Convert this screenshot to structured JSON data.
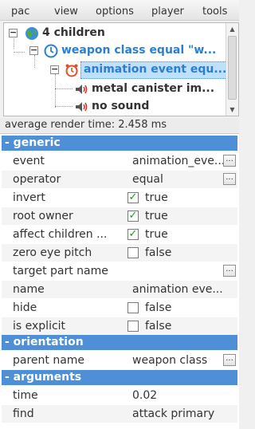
{
  "menu": [
    "pac",
    "view",
    "options",
    "player",
    "tools"
  ],
  "tree": {
    "root": "4 children",
    "child": "weapon class equal \"w...",
    "selected": "animation event equ...",
    "leaf1": "metal canister im...",
    "leaf2": "no sound"
  },
  "status": "average render time: 2.458 ms",
  "sections": {
    "generic": "- generic",
    "orientation": "- orientation",
    "arguments": "- arguments"
  },
  "props": {
    "event": {
      "name": "event",
      "value": "animation_eve..."
    },
    "operator": {
      "name": "operator",
      "value": "equal"
    },
    "invert": {
      "name": "invert",
      "value": "true"
    },
    "root_owner": {
      "name": "root owner",
      "value": "true"
    },
    "affect_children": {
      "name": "affect children ...",
      "value": "true"
    },
    "zero_eye_pitch": {
      "name": "zero eye pitch",
      "value": "false"
    },
    "target_part_name": {
      "name": "target part name",
      "value": ""
    },
    "name": {
      "name": "name",
      "value": "animation eve..."
    },
    "hide": {
      "name": "hide",
      "value": "false"
    },
    "is_explicit": {
      "name": "is explicit",
      "value": "false"
    },
    "parent_name": {
      "name": "parent name",
      "value": "weapon class"
    },
    "time": {
      "name": "time",
      "value": "0.02"
    },
    "find": {
      "name": "find",
      "value": "attack primary"
    }
  },
  "ellipsis_label": "...",
  "check_mark": "✓",
  "colors": {
    "section": "#4e8fd8",
    "selected_text": "#2a7fd4",
    "check": "#1a9a1a"
  }
}
